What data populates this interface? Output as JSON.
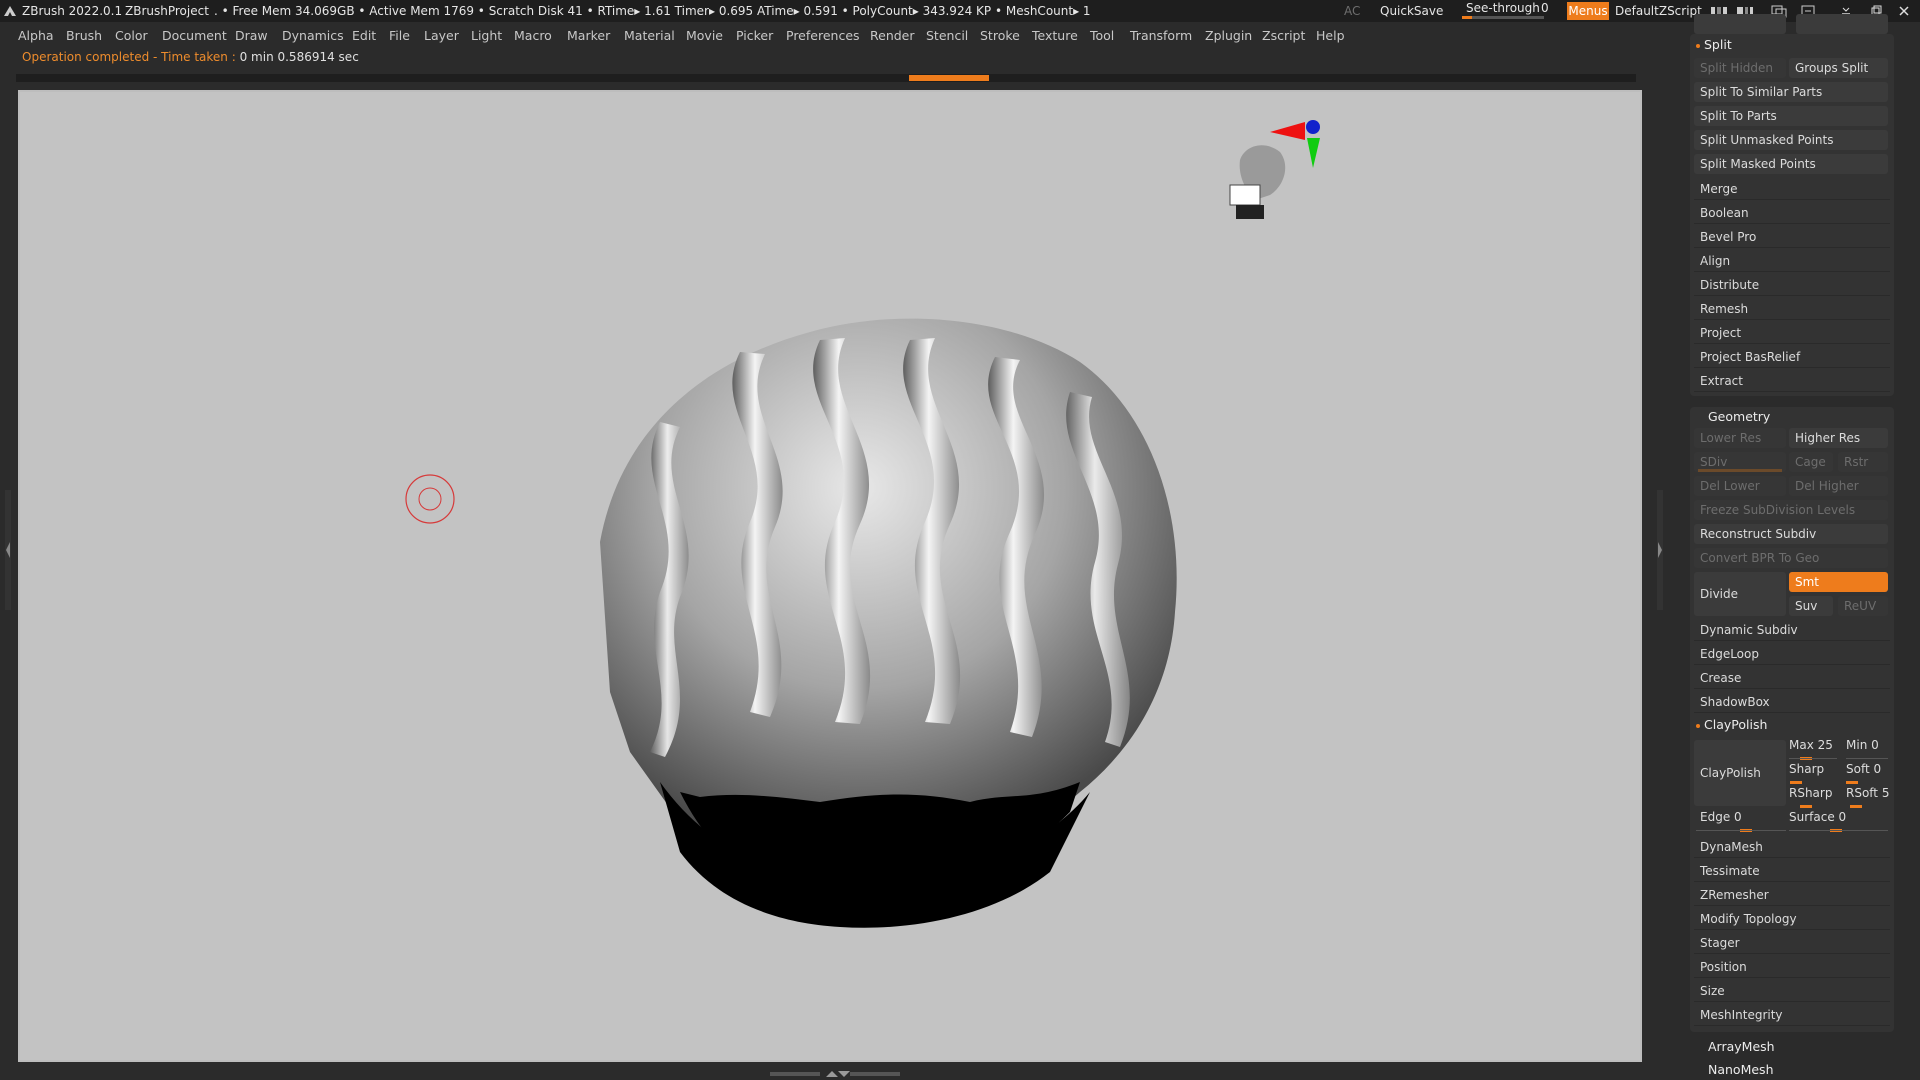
{
  "titlebar": {
    "app": "ZBrush 2022.0.1",
    "project": "ZBrushProject",
    "stats": ". • Free Mem 34.069GB • Active Mem 1769 • Scratch Disk 41 • RTime▸ 1.61 Timer▸ 0.695 ATime▸ 0.591 • PolyCount▸ 343.924 KP • MeshCount▸ 1",
    "ac": "AC",
    "quicksave": "QuickSave",
    "see_through_label": "See-through",
    "see_through_value": "0",
    "see_through_level": 0,
    "menus": "Menus",
    "script": "DefaultZScript"
  },
  "menubar": [
    "Alpha",
    "Brush",
    "Color",
    "Document",
    "Draw",
    "Dynamics",
    "Edit",
    "File",
    "Layer",
    "Light",
    "Macro",
    "Marker",
    "Material",
    "Movie",
    "Picker",
    "Preferences",
    "Render",
    "Stencil",
    "Stroke",
    "Texture",
    "Tool",
    "Transform",
    "Zplugin",
    "Zscript",
    "Help"
  ],
  "notice": {
    "prefix": "Operation completed - Time taken : ",
    "value": "0 min 0.586914 sec"
  },
  "colors": {
    "accent": "#ee7c1c",
    "viewport": "#c3c3c3",
    "panel": "#333333"
  },
  "split": {
    "title": "Split",
    "items": [
      "Split Hidden",
      "Groups Split",
      "Split To Similar Parts",
      "Split To Parts",
      "Split Unmasked Points",
      "Split Masked Points"
    ]
  },
  "subtool_rows": [
    "Merge",
    "Boolean",
    "Bevel Pro",
    "Align",
    "Distribute",
    "Remesh",
    "Project",
    "Project BasRelief",
    "Extract"
  ],
  "geometry": {
    "title": "Geometry",
    "lower_res": "Lower Res",
    "higher_res": "Higher Res",
    "sdiv": "SDiv",
    "cage": "Cage",
    "rstr": "Rstr",
    "del_lower": "Del Lower",
    "del_higher": "Del Higher",
    "freeze": "Freeze SubDivision Levels",
    "reconstruct": "Reconstruct Subdiv",
    "convert_bpr": "Convert BPR To Geo",
    "divide": "Divide",
    "smt": "Smt",
    "suv": "Suv",
    "reuv": "ReUV",
    "rows": [
      "Dynamic Subdiv",
      "EdgeLoop",
      "Crease",
      "ShadowBox"
    ]
  },
  "claypolish": {
    "title": "ClayPolish",
    "button": "ClayPolish",
    "max": "Max 25",
    "min": "Min 0",
    "sharp": "Sharp",
    "soft": "Soft 0",
    "rsharp": "RSharp",
    "rsoft": "RSoft 5",
    "edge": "Edge 0",
    "surface": "Surface 0"
  },
  "geometry_rows2": [
    "DynaMesh",
    "Tessimate",
    "ZRemesher",
    "Modify Topology",
    "Stager",
    "Position",
    "Size",
    "MeshIntegrity"
  ],
  "bottom_items": [
    "ArrayMesh",
    "NanoMesh"
  ]
}
